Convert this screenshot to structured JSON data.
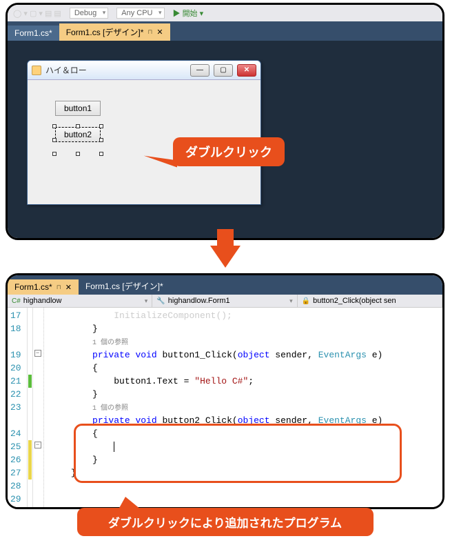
{
  "menubar": {
    "config": "Debug",
    "platform": "Any CPU",
    "run": "開始"
  },
  "tabs_top": [
    {
      "label": "Form1.cs*",
      "active": false
    },
    {
      "label": "Form1.cs [デザイン]*",
      "active": true
    }
  ],
  "tabs_bottom": [
    {
      "label": "Form1.cs*",
      "active": true
    },
    {
      "label": "Form1.cs [デザイン]*",
      "active": false
    }
  ],
  "form": {
    "title": "ハイ＆ロー",
    "button1": "button1",
    "button2": "button2"
  },
  "callout1": "ダブルクリック",
  "callout2": "ダブルクリックにより追加されたプログラム",
  "nav": {
    "namespace": "highandlow",
    "class": "highandlow.Form1",
    "method": "button2_Click(object sen"
  },
  "code": {
    "lines": [
      "17",
      "18",
      "19",
      "20",
      "21",
      "22",
      "23",
      "24",
      "25",
      "26",
      "27",
      "28",
      "29"
    ],
    "ref_text": "1 個の参照",
    "method1_sig_a": "private void ",
    "method1_name": "button1_Click",
    "method1_sig_b": "(",
    "method1_obj": "object",
    "method1_sig_c": " sender, ",
    "method1_type": "EventArgs",
    "method1_sig_d": " e)",
    "stmt_a": "button1.Text = ",
    "stmt_str": "\"Hello C#\"",
    "stmt_b": ";",
    "method2_name": "button2_Click",
    "init_fragment": "InitializeComponent();"
  }
}
